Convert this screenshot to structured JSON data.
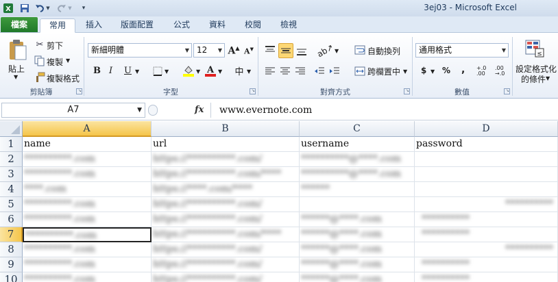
{
  "window": {
    "title_file": "3ej03",
    "title_sep": " - ",
    "title_app": "Microsoft Excel"
  },
  "tabs": [
    {
      "label": "檔案"
    },
    {
      "label": "常用"
    },
    {
      "label": "插入"
    },
    {
      "label": "版面配置"
    },
    {
      "label": "公式"
    },
    {
      "label": "資料"
    },
    {
      "label": "校閱"
    },
    {
      "label": "檢視"
    }
  ],
  "ribbon": {
    "clipboard": {
      "paste": "貼上",
      "cut": "剪下",
      "copy": "複製",
      "format_painter": "複製格式",
      "label": "剪貼簿"
    },
    "font": {
      "font_name": "新細明體",
      "font_size": "12",
      "bold": "B",
      "italic": "I",
      "underline": "U",
      "label": "字型"
    },
    "alignment": {
      "wrap_text": "自動換列",
      "merge_center": "跨欄置中",
      "label": "對齊方式"
    },
    "number": {
      "format": "通用格式",
      "currency": "$",
      "percent": "%",
      "comma": ",",
      "inc_decimal": "+.0 .00",
      "dec_decimal": ".00 →.0",
      "label": "數值"
    },
    "styles": {
      "conditional_format_line1": "設定格式化",
      "conditional_format_line2": "的條件"
    }
  },
  "formula_bar": {
    "name_box": "A7",
    "fx": "fx",
    "value": "www.evernote.com"
  },
  "grid": {
    "columns": [
      "A",
      "B",
      "C",
      "D"
    ],
    "rows": [
      "1",
      "2",
      "3",
      "4",
      "5",
      "6",
      "7",
      "8",
      "9",
      "10"
    ],
    "selected_cell": "A7",
    "header_row": [
      "name",
      "url",
      "username",
      "password"
    ],
    "blurred_rows": [
      [
        "**********.com",
        "https://**********.com/",
        "**********@****.com",
        ""
      ],
      [
        "**********.com",
        "https://**********.com/****",
        "**********@****.com",
        ""
      ],
      [
        "****.com",
        "https://****.com/****",
        "******",
        ""
      ],
      [
        "**********.com",
        "https://**********.com/",
        "",
        "**********"
      ],
      [
        "**********.com",
        "https://**********.com/",
        "******@****.com",
        "**********"
      ],
      [
        "**********.com",
        "https://**********.com/****",
        "******@****.com",
        "**********"
      ],
      [
        "**********.com",
        "https://**********.com/",
        "******@****.com",
        "**********"
      ],
      [
        "**********.com",
        "https://**********.com/",
        "******@****.com",
        "**********"
      ],
      [
        "**********.com",
        "https://**********.com/",
        "******@****.com",
        "**********"
      ]
    ]
  }
}
